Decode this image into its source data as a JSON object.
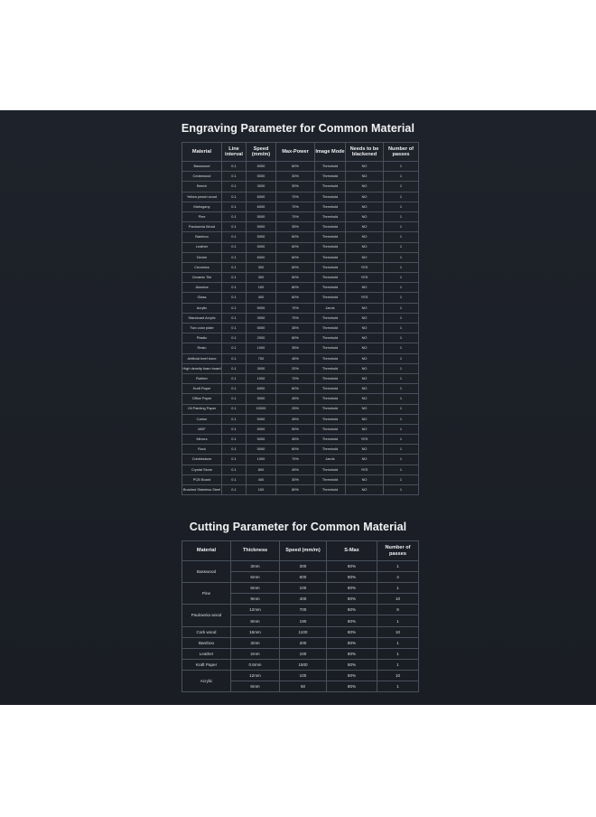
{
  "engraving": {
    "title": "Engraving Parameter for Common Material",
    "headers": [
      "Material",
      "Line interval",
      "Speed (mm/m)",
      "Max-Power",
      "Image Mode",
      "Needs to be blackened",
      "Number of passes"
    ],
    "rows": [
      [
        "Basswood",
        "0.1",
        "5000",
        "60%",
        "Threshold",
        "NO",
        "1"
      ],
      [
        "Cedarwood",
        "0.1",
        "5000",
        "30%",
        "Threshold",
        "NO",
        "1"
      ],
      [
        "Beech",
        "0.1",
        "3000",
        "30%",
        "Threshold",
        "NO",
        "1"
      ],
      [
        "Yellow peach wood",
        "0.1",
        "6000",
        "70%",
        "Threshold",
        "NO",
        "1"
      ],
      [
        "Mahogany",
        "0.1",
        "6000",
        "70%",
        "Threshold",
        "NO",
        "1"
      ],
      [
        "Pine",
        "0.1",
        "5000",
        "70%",
        "Threshold",
        "NO",
        "1"
      ],
      [
        "Paulownia Wood",
        "0.1",
        "5000",
        "35%",
        "Threshold",
        "NO",
        "1"
      ],
      [
        "Bamboo",
        "0.1",
        "5000",
        "60%",
        "Threshold",
        "NO",
        "1"
      ],
      [
        "Leather",
        "0.1",
        "5000",
        "60%",
        "Threshold",
        "NO",
        "1"
      ],
      [
        "Denim",
        "0.1",
        "6000",
        "60%",
        "Threshold",
        "NO",
        "1"
      ],
      [
        "Ceramics",
        "0.1",
        "300",
        "60%",
        "Threshold",
        "YES",
        "1"
      ],
      [
        "Ceramic Tile",
        "0.1",
        "300",
        "60%",
        "Threshold",
        "YES",
        "1"
      ],
      [
        "Alumina",
        "0.1",
        "100",
        "80%",
        "Threshold",
        "NO",
        "1"
      ],
      [
        "Glass",
        "0.1",
        "400",
        "60%",
        "Threshold",
        "YES",
        "1"
      ],
      [
        "Acrylic",
        "0.1",
        "5000",
        "70%",
        "Jarvis",
        "NO",
        "1"
      ],
      [
        "Standoard Acrylic",
        "0.1",
        "3000",
        "70%",
        "Threshold",
        "NO",
        "1"
      ],
      [
        "Two color plate",
        "0.1",
        "5000",
        "35%",
        "Threshold",
        "NO",
        "1"
      ],
      [
        "Plastic",
        "0.1",
        "2000",
        "80%",
        "Threshold",
        "NO",
        "1"
      ],
      [
        "Resin",
        "0.1",
        "1000",
        "35%",
        "Threshold",
        "NO",
        "1"
      ],
      [
        "Artificial beef bone",
        "0.1",
        "700",
        "45%",
        "Threshold",
        "NO",
        "1"
      ],
      [
        "High density foam board",
        "0.1",
        "3000",
        "20%",
        "Threshold",
        "NO",
        "1"
      ],
      [
        "Rubber",
        "0.1",
        "1000",
        "70%",
        "Threshold",
        "NO",
        "1"
      ],
      [
        "Kraft Paper",
        "0.1",
        "6000",
        "60%",
        "Threshold",
        "NO",
        "1"
      ],
      [
        "Office Paper",
        "0.1",
        "5000",
        "45%",
        "Threshold",
        "NO",
        "1"
      ],
      [
        "Oil Painting Paper",
        "0.1",
        "10000",
        "25%",
        "Threshold",
        "NO",
        "1"
      ],
      [
        "Carton",
        "0.1",
        "5000",
        "45%",
        "Threshold",
        "NO",
        "1"
      ],
      [
        "MDF",
        "0.1",
        "5000",
        "50%",
        "Threshold",
        "NO",
        "1"
      ],
      [
        "Mirrors",
        "0.1",
        "5000",
        "45%",
        "Threshold",
        "YES",
        "1"
      ],
      [
        "Rock",
        "0.1",
        "5000",
        "60%",
        "Threshold",
        "NO",
        "1"
      ],
      [
        "Cobblestone",
        "0.1",
        "1000",
        "70%",
        "Jarvis",
        "NO",
        "1"
      ],
      [
        "Crystal Stone",
        "0.1",
        "800",
        "45%",
        "Threshold",
        "YES",
        "1"
      ],
      [
        "PCB Board",
        "0.1",
        "400",
        "30%",
        "Threshold",
        "NO",
        "1"
      ],
      [
        "Brushed Stainless Steel",
        "0.1",
        "100",
        "80%",
        "Threshold",
        "NO",
        "1"
      ]
    ]
  },
  "cutting": {
    "title": "Cutting Parameter for Common Material",
    "headers": [
      "Material",
      "Thickness",
      "Speed (mm/m)",
      "S-Max",
      "Number of passes"
    ],
    "groups": [
      {
        "material": "Basswood",
        "rows": [
          [
            "3mm",
            "300",
            "80%",
            "1"
          ],
          [
            "5mm",
            "600",
            "80%",
            "4"
          ]
        ]
      },
      {
        "material": "Pine",
        "rows": [
          [
            "6mm",
            "100",
            "80%",
            "1"
          ],
          [
            "9mm",
            "400",
            "80%",
            "10"
          ]
        ]
      },
      {
        "material": "Paulownia wood",
        "rows": [
          [
            "12mm",
            "700",
            "80%",
            "8"
          ],
          [
            "8mm",
            "190",
            "80%",
            "1"
          ]
        ]
      },
      {
        "material": "Cork wood",
        "rows": [
          [
            "16mm",
            "1100",
            "80%",
            "10"
          ]
        ]
      },
      {
        "material": "Bamboo",
        "rows": [
          [
            "3mm",
            "200",
            "80%",
            "1"
          ]
        ]
      },
      {
        "material": "Leather",
        "rows": [
          [
            "2mm",
            "100",
            "80%",
            "1"
          ]
        ]
      },
      {
        "material": "Kraft Paper",
        "rows": [
          [
            "0.6mm",
            "1500",
            "80%",
            "1"
          ]
        ]
      },
      {
        "material": "Acrylic",
        "rows": [
          [
            "12mm",
            "100",
            "80%",
            "10"
          ],
          [
            "6mm",
            "50",
            "80%",
            "1"
          ]
        ]
      }
    ]
  }
}
